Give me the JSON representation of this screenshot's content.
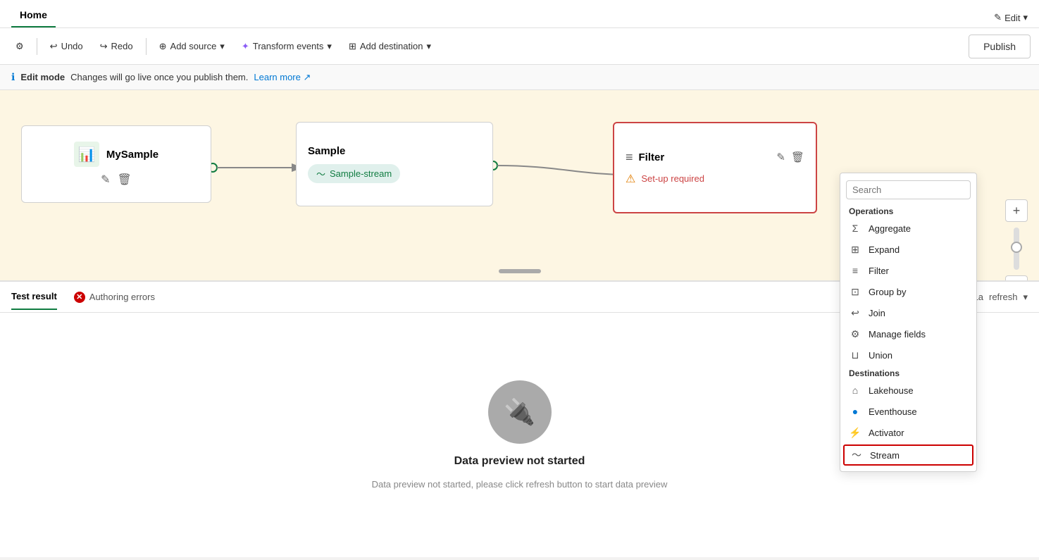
{
  "titlebar": {
    "tab": "Home",
    "edit_label": "Edit",
    "edit_icon": "✎"
  },
  "toolbar": {
    "undo_label": "Undo",
    "redo_label": "Redo",
    "add_source_label": "Add source",
    "transform_events_label": "Transform events",
    "add_destination_label": "Add destination",
    "publish_label": "Publish"
  },
  "infobar": {
    "mode_label": "Edit mode",
    "message": "Changes will go live once you publish them.",
    "learn_more": "Learn more"
  },
  "nodes": {
    "mysample": {
      "title": "MySample",
      "edit_icon": "✎",
      "delete_icon": "🗑"
    },
    "sample": {
      "title": "Sample",
      "stream_label": "Sample-stream"
    },
    "filter": {
      "title": "Filter",
      "status": "Set-up required",
      "edit_icon": "✎",
      "delete_icon": "🗑"
    }
  },
  "bottom": {
    "tab_test": "Test result",
    "tab_errors": "Authoring errors",
    "refresh_label": "refresh",
    "last_label": "La",
    "chevron_label": "▾",
    "preview_title": "Data preview not started",
    "preview_subtitle": "Data preview not started, please click refresh button to start data preview"
  },
  "dropdown": {
    "search_placeholder": "Search",
    "operations_title": "Operations",
    "items": [
      {
        "label": "Aggregate",
        "icon": "Σ"
      },
      {
        "label": "Expand",
        "icon": "⊞"
      },
      {
        "label": "Filter",
        "icon": "≡"
      },
      {
        "label": "Group by",
        "icon": "⊡"
      },
      {
        "label": "Join",
        "icon": "↩"
      },
      {
        "label": "Manage fields",
        "icon": "⚙"
      },
      {
        "label": "Union",
        "icon": "⊔"
      }
    ],
    "destinations_title": "Destinations",
    "destinations": [
      {
        "label": "Lakehouse",
        "icon": "⌂"
      },
      {
        "label": "Eventhouse",
        "icon": "●"
      },
      {
        "label": "Activator",
        "icon": "⚡"
      },
      {
        "label": "Stream",
        "icon": "〜"
      }
    ]
  }
}
